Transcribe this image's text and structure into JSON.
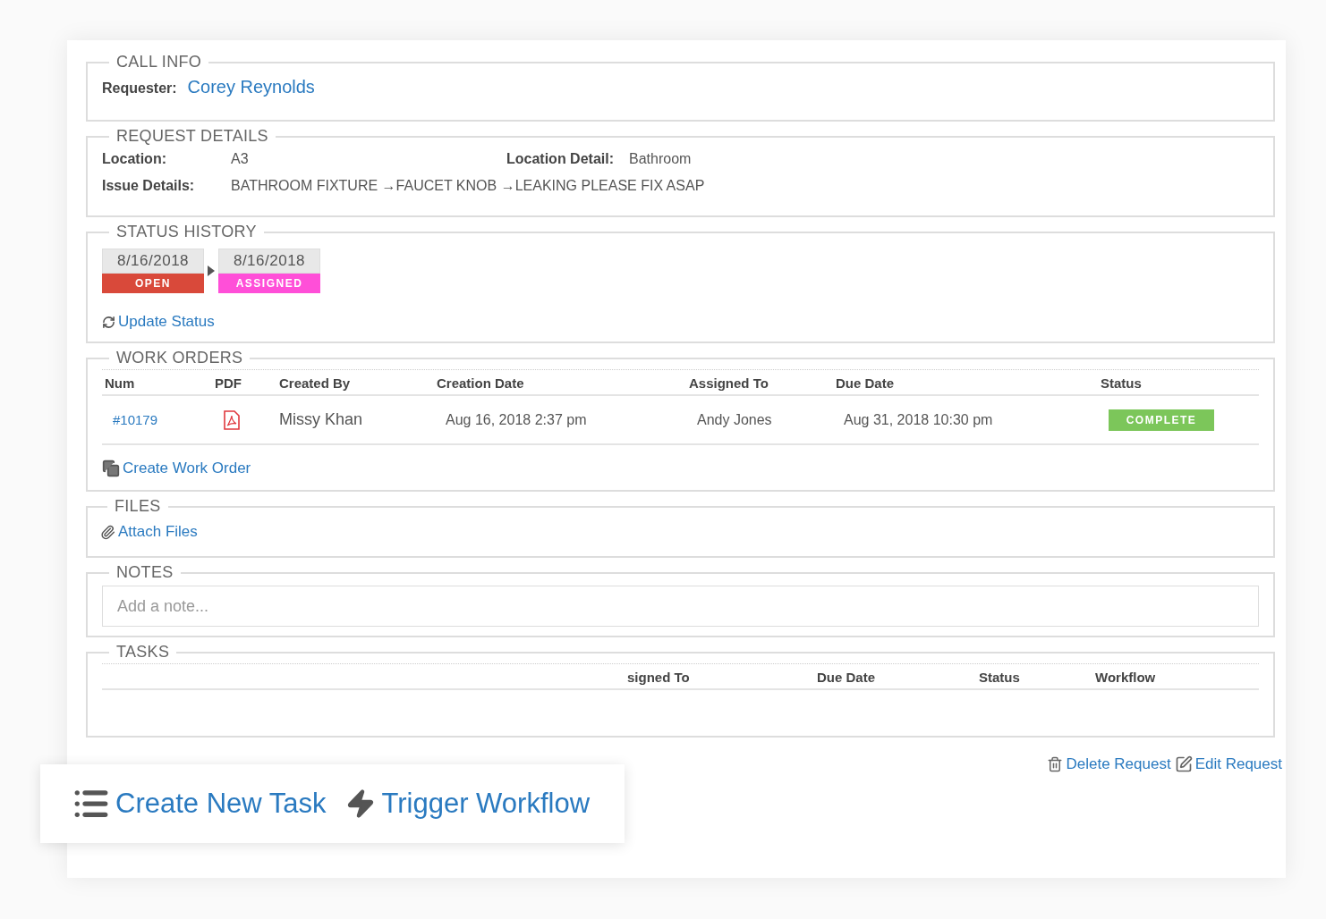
{
  "call_info": {
    "title": "CALL INFO",
    "requester_label": "Requester:",
    "requester": "Corey Reynolds"
  },
  "request_details": {
    "title": "REQUEST DETAILS",
    "fields": [
      {
        "label": "Location:",
        "value": "A3"
      },
      {
        "label": "Location Detail:",
        "value": "Bathroom"
      },
      {
        "label": "Issue Details:",
        "value": "BATHROOM FIXTURE →FAUCET KNOB →LEAKING PLEASE FIX ASAP"
      }
    ]
  },
  "status_history": {
    "title": "STATUS HISTORY",
    "entries": [
      {
        "date": "8/16/2018",
        "status": "OPEN",
        "color": "#d9493a"
      },
      {
        "date": "8/16/2018",
        "status": "ASSIGNED",
        "color": "#ff4fd8"
      }
    ],
    "action": "Update Status"
  },
  "work_orders": {
    "title": "WORK ORDERS",
    "columns": [
      "Num",
      "PDF",
      "Created By",
      "Creation Date",
      "Assigned To",
      "Due Date",
      "Status"
    ],
    "rows": [
      {
        "num": "#10179",
        "created_by": "Missy Khan",
        "creation_date": "Aug 16, 2018 2:37 pm",
        "assigned_to": "Andy Jones",
        "due_date": "Aug 31, 2018 10:30 pm",
        "status": "COMPLETE"
      }
    ],
    "action": "Create Work Order"
  },
  "files": {
    "title": "FILES",
    "action": "Attach Files"
  },
  "notes": {
    "title": "NOTES",
    "placeholder": "Add a note..."
  },
  "tasks": {
    "title": "TASKS",
    "columns": [
      "signed To",
      "Due Date",
      "Status",
      "Workflow"
    ]
  },
  "popup": {
    "actions": [
      {
        "kind": "list",
        "label": "Create New Task"
      },
      {
        "kind": "bolt",
        "label": "Trigger Workflow"
      }
    ]
  },
  "footer": {
    "actions": [
      {
        "kind": "delete",
        "label": "Delete Request"
      },
      {
        "kind": "edit",
        "label": "Edit Request"
      }
    ]
  }
}
